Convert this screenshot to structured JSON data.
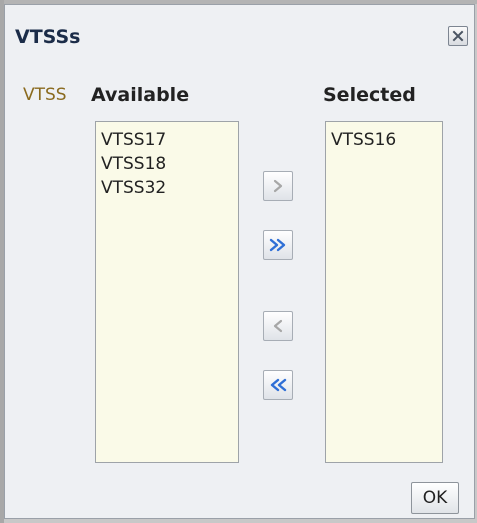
{
  "dialog": {
    "title": "VTSSs",
    "field_label": "VTSS",
    "available_title": "Available",
    "selected_title": "Selected",
    "available_items": [
      "VTSS17",
      "VTSS18",
      "VTSS32"
    ],
    "selected_items": [
      "VTSS16"
    ],
    "ok_label": "OK"
  },
  "icons": {
    "close": "close-icon",
    "move": "chevron-right-icon",
    "move_all": "double-chevron-right-icon",
    "remove": "chevron-left-icon",
    "remove_all": "double-chevron-left-icon"
  },
  "colors": {
    "title": "#1b2c48",
    "field_label": "#8a6a1e",
    "list_background": "#fafae8",
    "accent_blue": "#2f6fd6",
    "disabled_gray": "#a7a7a7"
  }
}
